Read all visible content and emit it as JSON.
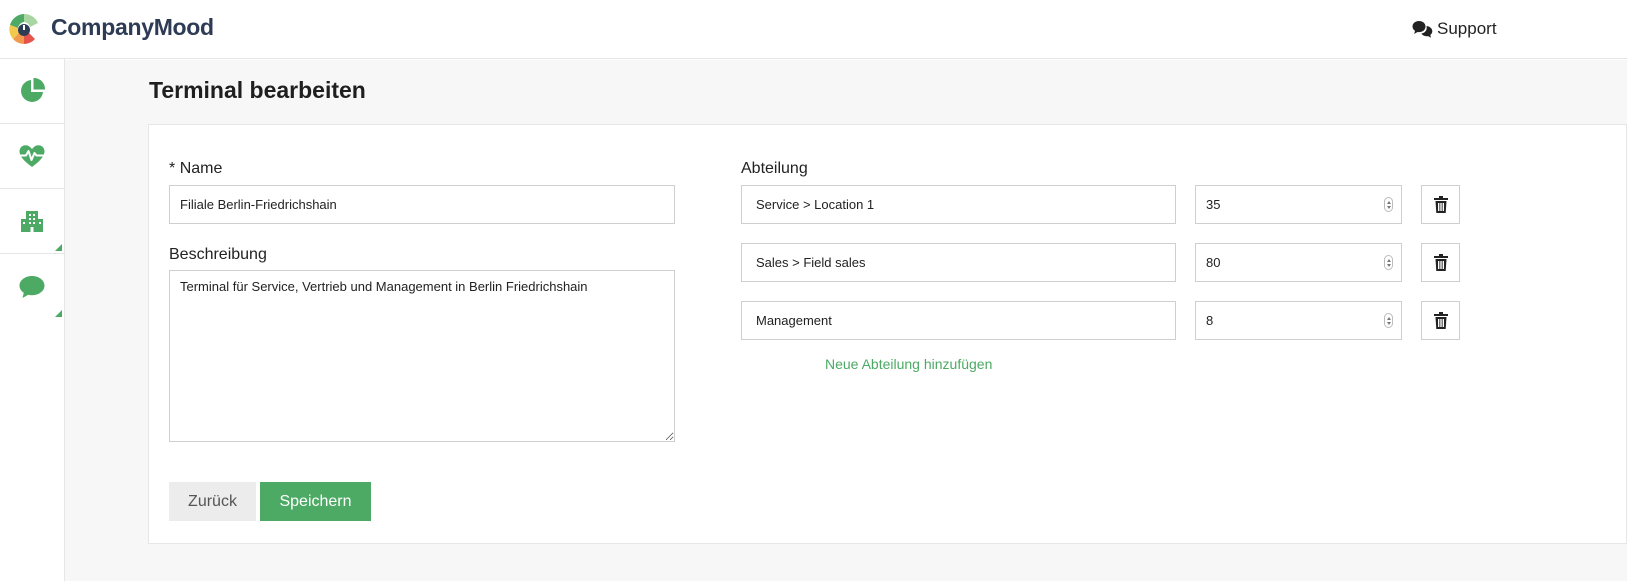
{
  "brand": {
    "name": "CompanyMood",
    "colors": {
      "green": "#4caa64",
      "navy": "#2d3b55",
      "yellow": "#f2c94c",
      "red": "#e5534b",
      "light_green": "#a8d5a2"
    }
  },
  "header": {
    "support_label": "Support",
    "support_icon": "chat-bubbles-icon"
  },
  "sidebar": {
    "items": [
      {
        "name": "dashboard",
        "icon": "pie-chart-icon"
      },
      {
        "name": "health",
        "icon": "heart-pulse-icon"
      },
      {
        "name": "organization",
        "icon": "building-icon"
      },
      {
        "name": "feedback",
        "icon": "speech-bubble-icon"
      }
    ]
  },
  "page": {
    "title": "Terminal bearbeiten"
  },
  "form": {
    "name_required_marker": "*",
    "name_label": "Name",
    "name_value": "Filiale Berlin-Friedrichshain",
    "description_label": "Beschreibung",
    "description_value": "Terminal für Service, Vertrieb und Management in Berlin Friedrichshain",
    "department_label": "Abteilung",
    "departments": [
      {
        "name": "Service > Location 1",
        "count": "35"
      },
      {
        "name": "Sales > Field sales",
        "count": "80"
      },
      {
        "name": "Management",
        "count": "8"
      }
    ],
    "add_department_label": "Neue Abteilung hinzufügen",
    "back_label": "Zurück",
    "save_label": "Speichern"
  }
}
